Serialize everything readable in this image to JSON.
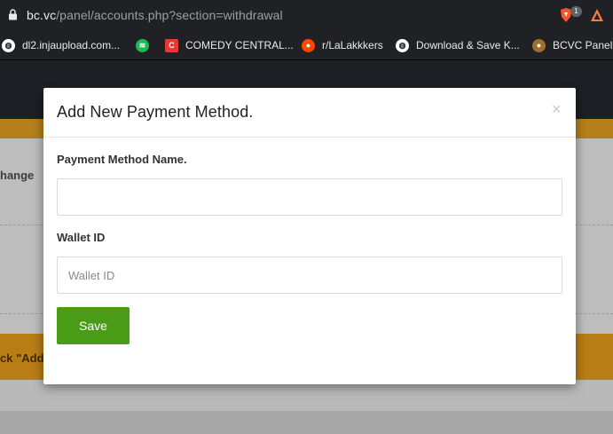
{
  "browser": {
    "url_host": "bc.vc",
    "url_path": "/panel/accounts.php?section=withdrawal",
    "extension_badge": "1",
    "bookmarks": [
      {
        "label": "dl2.injaupload.com...",
        "icon": "globe-icon",
        "color": "#ffffff"
      },
      {
        "label": "",
        "icon": "spotify-icon",
        "color": "#1db954"
      },
      {
        "label": "COMEDY CENTRAL...",
        "icon": "comedy-central-icon",
        "color": "#e53935"
      },
      {
        "label": "r/LaLakkkers",
        "icon": "reddit-icon",
        "color": "#ff4500"
      },
      {
        "label": "Download & Save K...",
        "icon": "globe-icon",
        "color": "#ffffff"
      },
      {
        "label": "BCVC Panel D",
        "icon": "bcvc-icon",
        "color": "#a0702a"
      }
    ]
  },
  "background_page": {
    "partial_heading": "hange",
    "partial_banner": "ck \"Add"
  },
  "modal": {
    "title": "Add New Payment Method.",
    "close_symbol": "×",
    "name_label": "Payment Method Name.",
    "name_value": "",
    "name_placeholder": "",
    "wallet_label": "Wallet ID",
    "wallet_value": "",
    "wallet_placeholder": "Wallet ID",
    "save_label": "Save",
    "colors": {
      "save_button": "#4a9c17"
    }
  }
}
